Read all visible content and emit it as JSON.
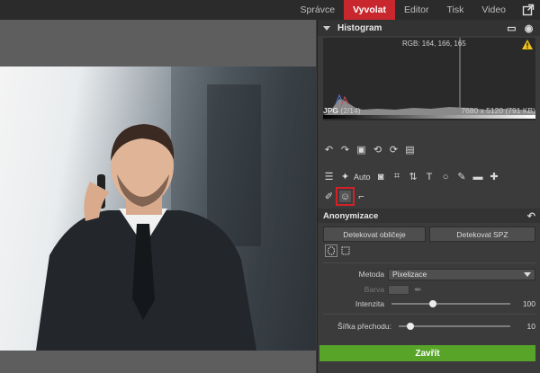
{
  "top_tabs": [
    "Správce",
    "Vyvolat",
    "Editor",
    "Tisk",
    "Video"
  ],
  "active_tab": "Vyvolat",
  "histogram": {
    "title": "Histogram",
    "rgb_readout": "RGB: 164, 166, 165"
  },
  "file": {
    "format": "JPG",
    "index": "(2/14)",
    "dimensions": "7680 x 5120 (791 KB)"
  },
  "tools": {
    "auto_label": "Auto"
  },
  "anon": {
    "title": "Anonymizace",
    "detect_faces": "Detekovat obličeje",
    "detect_plates": "Detekovat SPZ",
    "method_label": "Metoda",
    "method_value": "Pixelizace",
    "color_label": "Barva",
    "intensity_label": "Intenzita",
    "intensity_value": "100",
    "intensity": 1.0,
    "transition_label": "Šířka přechodu:",
    "transition_value": "10",
    "transition": 0.1,
    "close_label": "Zavřít"
  },
  "colors": {
    "accent_red": "#c8282d",
    "confirm_green": "#57a428"
  }
}
